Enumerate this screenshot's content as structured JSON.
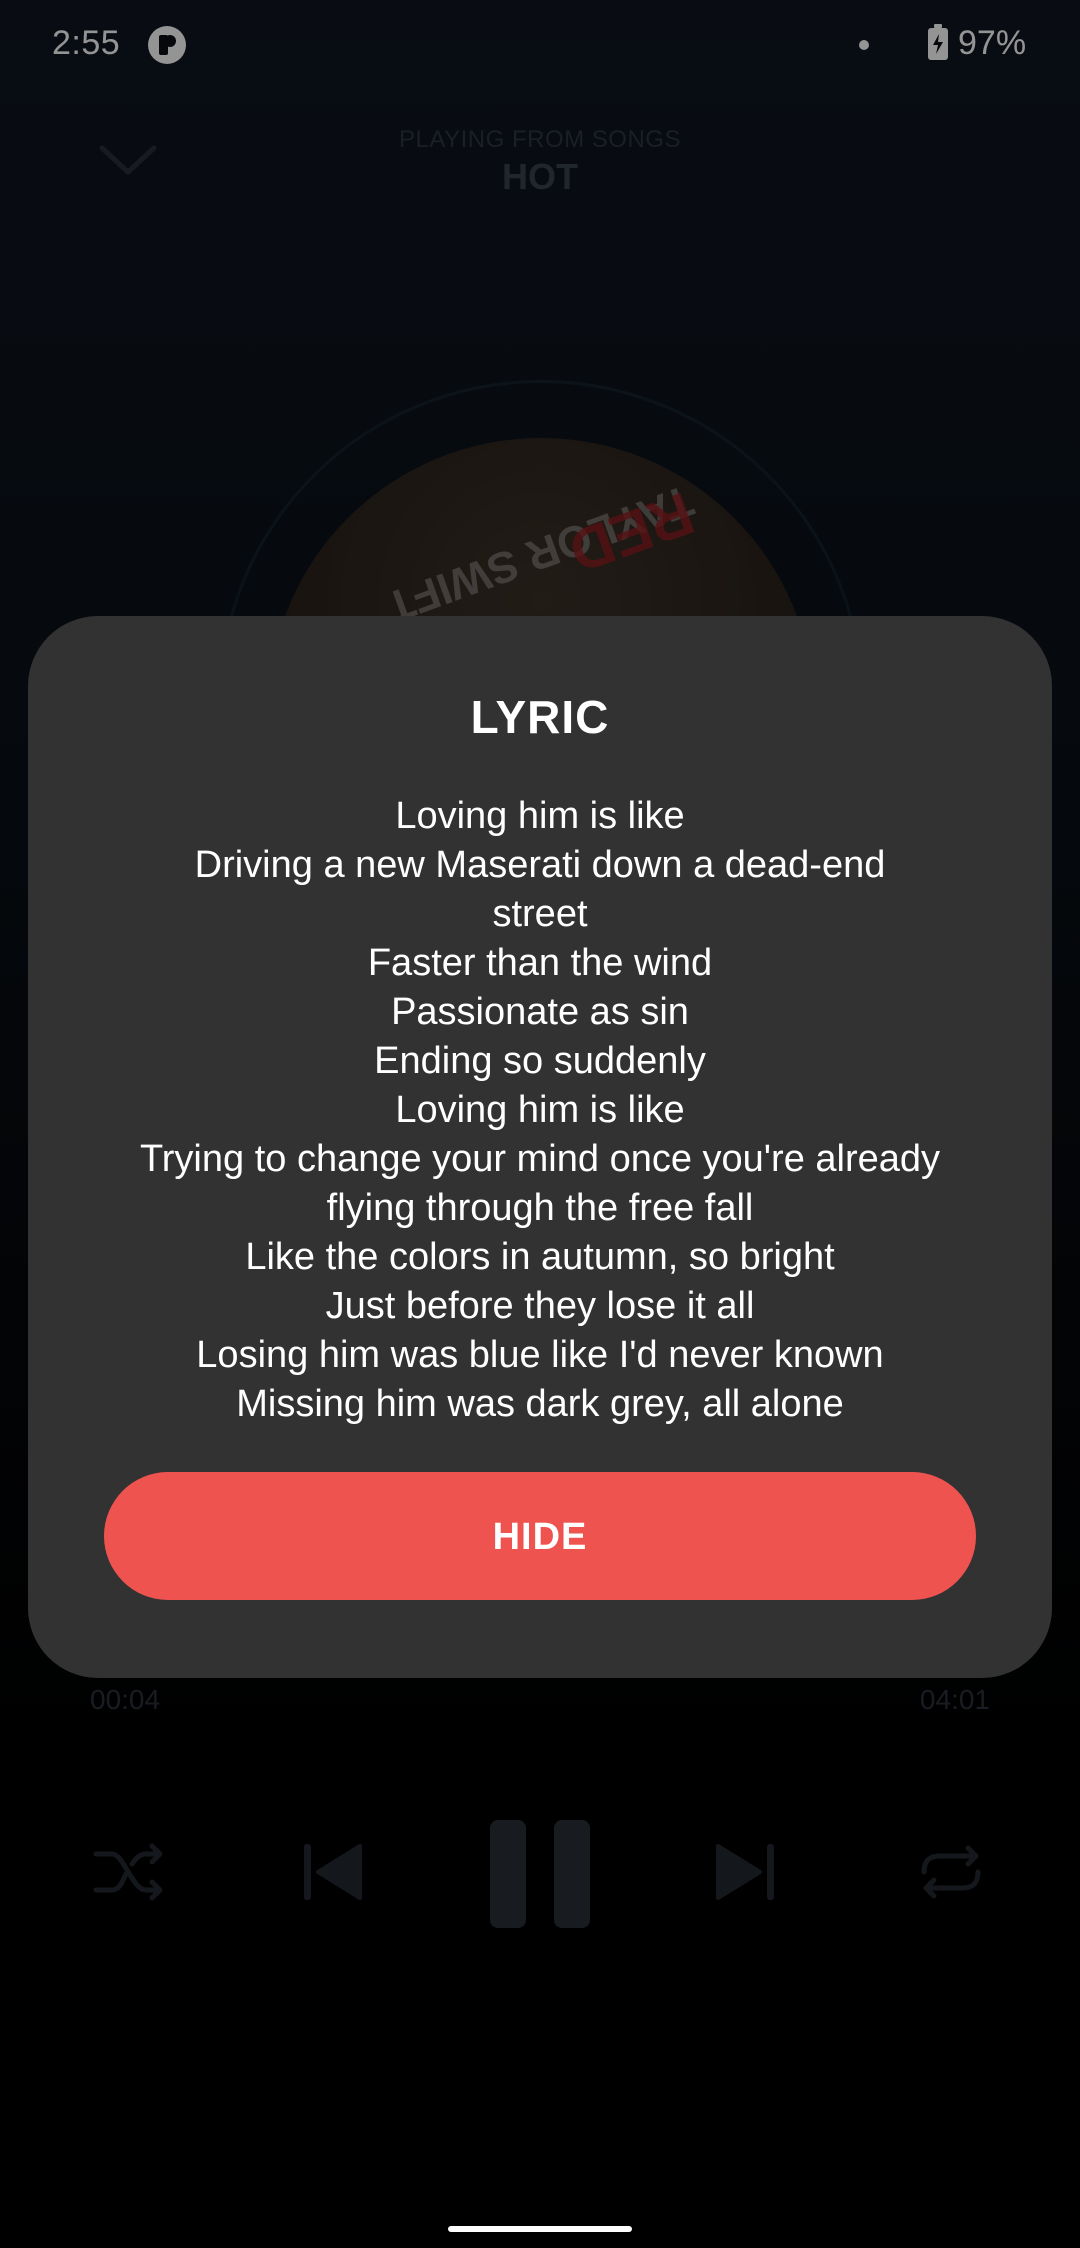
{
  "status_bar": {
    "time": "2:55",
    "battery": "97%",
    "app_icon": "pocket-casts-like-icon"
  },
  "player": {
    "source_label": "PLAYING FROM SONGS",
    "title": "HOT",
    "album_art_text_1": "TAYLOR SWIFT",
    "album_art_text_2": "RED",
    "elapsed": "00:04",
    "total": "04:01"
  },
  "dialog": {
    "title": "LYRIC",
    "lines": [
      "Loving him is like",
      "Driving a new Maserati down a dead-end",
      "street",
      "Faster than the wind",
      "Passionate as sin",
      "Ending so suddenly",
      "Loving him is like",
      "Trying to change your mind once you're already",
      "flying through the free fall",
      "Like the colors in autumn, so bright",
      "Just before they lose it all",
      "Losing him was blue like I'd never known",
      "Missing him was dark grey, all alone"
    ],
    "hide_label": "HIDE",
    "accent_color": "#ef5350"
  },
  "icons": {
    "collapse": "chevron-down-icon",
    "shuffle": "shuffle-icon",
    "previous": "skip-previous-icon",
    "pause": "pause-icon",
    "next": "skip-next-icon",
    "repeat": "repeat-icon"
  }
}
